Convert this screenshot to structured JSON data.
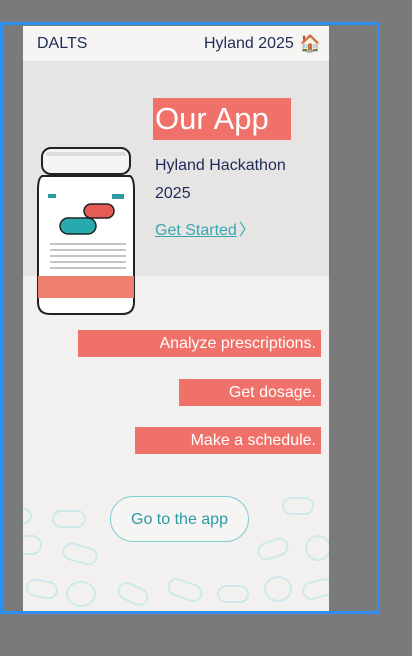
{
  "header": {
    "brand": "DALTS",
    "event": "Hyland 2025",
    "home_icon": "🏠"
  },
  "hero": {
    "title": "Our App",
    "subtitle": "Hyland Hackathon 2025",
    "cta_link": "Get Started",
    "chevron": "〉"
  },
  "features": [
    "Analyze prescriptions.",
    "Get dosage.",
    "Make a schedule."
  ],
  "primary_button": "Go to the app",
  "colors": {
    "accent": "#f07169",
    "teal": "#3aa8b1",
    "navy": "#1e2b58",
    "frame": "#2f8ff0"
  }
}
